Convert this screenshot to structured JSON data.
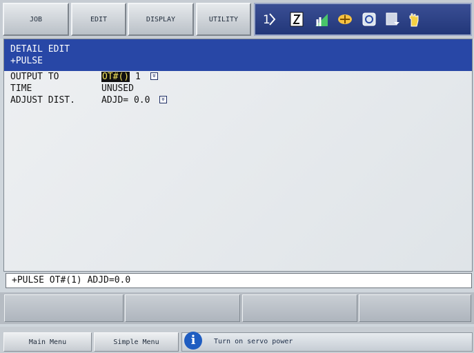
{
  "menu": {
    "job": "JOB",
    "edit": "EDIT",
    "display": "DISPLAY",
    "utility": "UTILITY"
  },
  "status_icons": [
    "cursor-mode-icon",
    "edit-mode-icon",
    "signal-icon",
    "coordinate-icon",
    "safety-icon",
    "save-icon",
    "hand-icon"
  ],
  "panel": {
    "title_line1": "DETAIL EDIT",
    "title_line2": "+PULSE",
    "rows": [
      {
        "label": "OUTPUT TO",
        "value_prefix": "OT#()",
        "value_suffix": "1"
      },
      {
        "label": "TIME",
        "value": "UNUSED"
      },
      {
        "label": "ADJUST DIST.",
        "value": "ADJD= 0.0"
      }
    ]
  },
  "input_line": "+PULSE OT#(1) ADJD=0.0",
  "bottom": {
    "main_menu": "Main Menu",
    "simple_menu": "Simple Menu",
    "message": "Turn on servo power"
  },
  "colors": {
    "title_bar": "#2847a6",
    "status_bar": "#223779",
    "highlight": "#f2e25a",
    "info": "#1f5dc1"
  }
}
